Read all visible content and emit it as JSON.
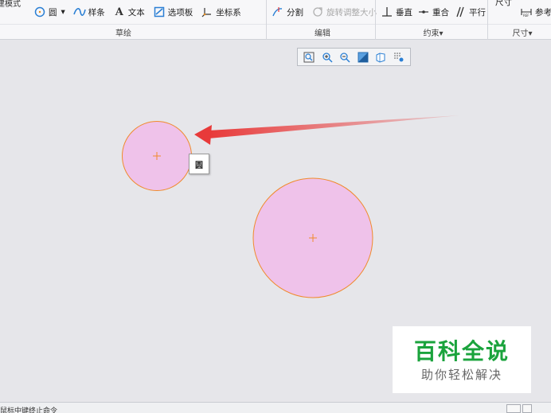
{
  "ribbon": {
    "left_clip": "建模式",
    "sketch_tools": {
      "circle": "圆",
      "spline": "样条",
      "text": "文本",
      "palette": "选项板",
      "coord": "坐标系"
    },
    "edit_tools": {
      "divide": "分割",
      "rotate_resize": "旋转调整大小"
    },
    "constraint_tools": {
      "vertical": "垂直",
      "coincident": "重合",
      "parallel": "平行"
    },
    "dimension_tools": {
      "dimension": "尺寸",
      "reference": "参考"
    },
    "groups": {
      "sketch": "草绘",
      "edit": "编辑",
      "constrain": "约束",
      "dimension": "尺寸"
    },
    "dropdown_caret": "▾"
  },
  "graphics_toolbar": {
    "icons": [
      "zoom-fit-icon",
      "zoom-in-icon",
      "zoom-out-icon",
      "display-style-icon",
      "saved-views-icon",
      "sketch-display-icon"
    ]
  },
  "tooltip": {
    "text": "圆"
  },
  "watermark": {
    "title": "百科全说",
    "subtitle": "助你轻松解决"
  },
  "status": {
    "text": "鼠标中键终止命令"
  },
  "colors": {
    "circle_fill": "#efc2ea",
    "circle_stroke": "#f08a2c",
    "arrow": "#e83a3a",
    "brand_green": "#1aa33c",
    "canvas_bg": "#e6e6ea"
  }
}
